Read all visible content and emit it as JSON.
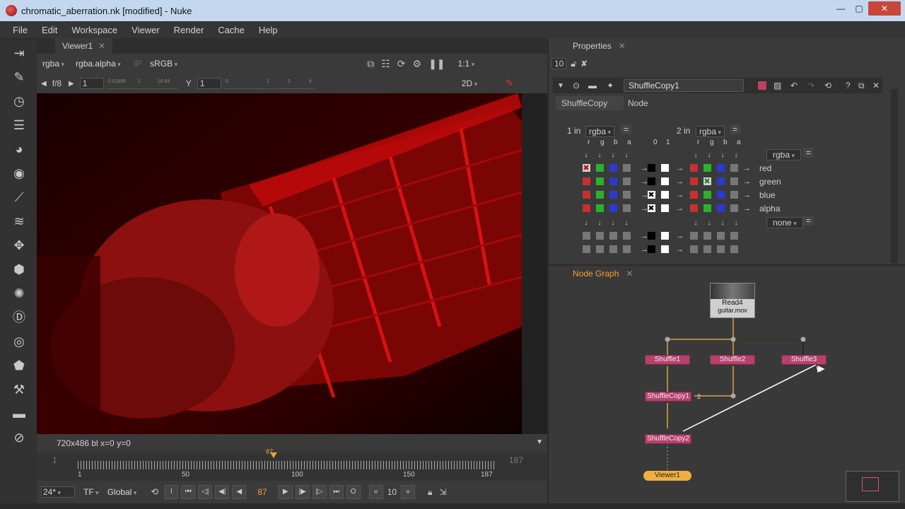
{
  "window": {
    "title": "chromatic_aberration.nk [modified] - Nuke",
    "controls": [
      "—",
      "▢",
      "✕"
    ]
  },
  "menu": [
    "File",
    "Edit",
    "Workspace",
    "Viewer",
    "Render",
    "Cache",
    "Help"
  ],
  "viewer": {
    "tab": "Viewer1",
    "channels": "rgba",
    "alpha": "rgba.alpha",
    "ip": "IP",
    "lut": "sRGB",
    "zoom": "1:1",
    "fstop": "f/8",
    "gain": "1",
    "gain_ticks": [
      "0.01895",
      "1",
      "10.64"
    ],
    "gamma_label": "Y",
    "gamma": "1",
    "gamma_ticks": [
      "0",
      "1",
      "2",
      "4"
    ],
    "mode": "2D",
    "status": "720x486  bl  x=0 y=0"
  },
  "timeline": {
    "in": "1",
    "out": "187",
    "ticks": [
      "1",
      "50",
      "100",
      "150",
      "187"
    ],
    "current": "87",
    "fps": "24*",
    "tf": "TF",
    "scope": "Global",
    "frame": "87",
    "step": "10"
  },
  "properties": {
    "tab": "Properties",
    "max_panels": "10",
    "node_name": "ShuffleCopy1",
    "tabs": [
      "ShuffleCopy",
      "Node"
    ],
    "in1_label": "1 in",
    "in1": "rgba",
    "in2_label": "2 in",
    "in2": "rgba",
    "const_labels": [
      "0",
      "1"
    ],
    "chan_labels": [
      "r",
      "g",
      "b",
      "a"
    ],
    "out_layer": "rgba",
    "out_channels": [
      "red",
      "green",
      "blue",
      "alpha"
    ],
    "out2": "none"
  },
  "node_graph": {
    "tab": "Node Graph",
    "read_node": "Read4",
    "read_file": "guitar.mov",
    "nodes": [
      "Shuffle1",
      "Shuffle2",
      "Shuffle3",
      "ShuffleCopy1",
      "ShuffleCopy2",
      "Viewer1"
    ],
    "pipe_label": "2"
  },
  "colors": {
    "accent": "#b8406e",
    "viewer_bg": "#000000",
    "title_bar": "#c3d8ef"
  }
}
